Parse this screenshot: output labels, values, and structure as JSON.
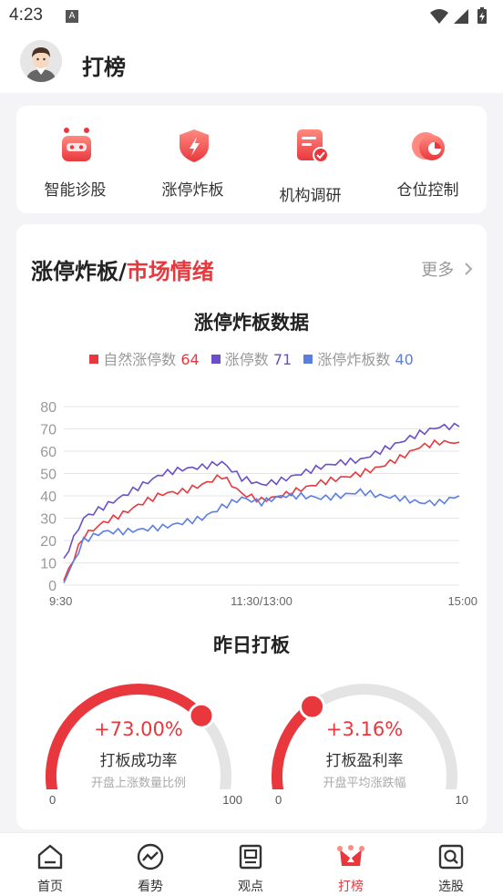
{
  "status_bar": {
    "time": "4:23",
    "notification_icon": "A"
  },
  "header": {
    "title": "打榜",
    "avatar_icon": "user-avatar"
  },
  "tools": [
    {
      "label": "智能诊股",
      "icon": "robot-icon"
    },
    {
      "label": "涨停炸板",
      "icon": "shield-lightning-icon"
    },
    {
      "label": "机构调研",
      "icon": "document-check-icon"
    },
    {
      "label": "仓位控制",
      "icon": "pie-clock-icon"
    }
  ],
  "market": {
    "heading_part1": "涨停炸板/",
    "heading_part2": "市场情绪",
    "more_label": "更多",
    "chart_title": "涨停炸板数据",
    "legend": [
      {
        "name": "自然涨停数",
        "value": "64",
        "color": "#e8383d"
      },
      {
        "name": "涨停数",
        "value": "71",
        "color": "#6a4fc8"
      },
      {
        "name": "涨停炸板数",
        "value": "40",
        "color": "#5b7ee0"
      }
    ],
    "section2_title": "昨日打板",
    "gauges": [
      {
        "value": "+73.00%",
        "name": "打板成功率",
        "sub": "开盘上涨数量比例",
        "min": "0",
        "max": "100",
        "fraction": 0.73
      },
      {
        "value": "+3.16%",
        "name": "打板盈利率",
        "sub": "开盘平均涨跌幅",
        "min": "0",
        "max": "10",
        "fraction": 0.316
      }
    ]
  },
  "chart_data": {
    "type": "line",
    "title": "涨停炸板数据",
    "x_ticks": [
      "9:30",
      "11:30/13:00",
      "15:00"
    ],
    "ylim": [
      0,
      80
    ],
    "y_ticks": [
      0,
      10,
      20,
      30,
      40,
      50,
      60,
      70,
      80
    ],
    "grid": true,
    "legend_position": "top",
    "x": [
      0,
      5,
      10,
      15,
      20,
      25,
      30,
      35,
      40,
      45,
      50,
      55,
      60,
      65,
      70,
      75,
      80,
      85,
      90,
      95,
      100
    ],
    "series": [
      {
        "name": "自然涨停数",
        "color": "#e8383d",
        "values": [
          2,
          22,
          28,
          32,
          37,
          41,
          42,
          45,
          49,
          41,
          38,
          40,
          43,
          46,
          48,
          50,
          53,
          57,
          62,
          64,
          64
        ]
      },
      {
        "name": "涨停数",
        "color": "#6a4fc8",
        "values": [
          12,
          30,
          35,
          40,
          45,
          50,
          52,
          53,
          55,
          48,
          45,
          47,
          50,
          53,
          55,
          56,
          60,
          64,
          68,
          71,
          71
        ]
      },
      {
        "name": "涨停炸板数",
        "color": "#5b7ee0",
        "values": [
          1,
          20,
          24,
          24,
          25,
          26,
          28,
          30,
          35,
          39,
          37,
          40,
          40,
          39,
          40,
          42,
          40,
          39,
          37,
          37,
          40
        ]
      }
    ]
  },
  "tabbar": [
    {
      "label": "首页",
      "icon": "home-icon",
      "active": false
    },
    {
      "label": "看势",
      "icon": "trend-icon",
      "active": false
    },
    {
      "label": "观点",
      "icon": "board-icon",
      "active": false
    },
    {
      "label": "打榜",
      "icon": "trophy-icon",
      "active": true
    },
    {
      "label": "选股",
      "icon": "search-box-icon",
      "active": false
    }
  ]
}
